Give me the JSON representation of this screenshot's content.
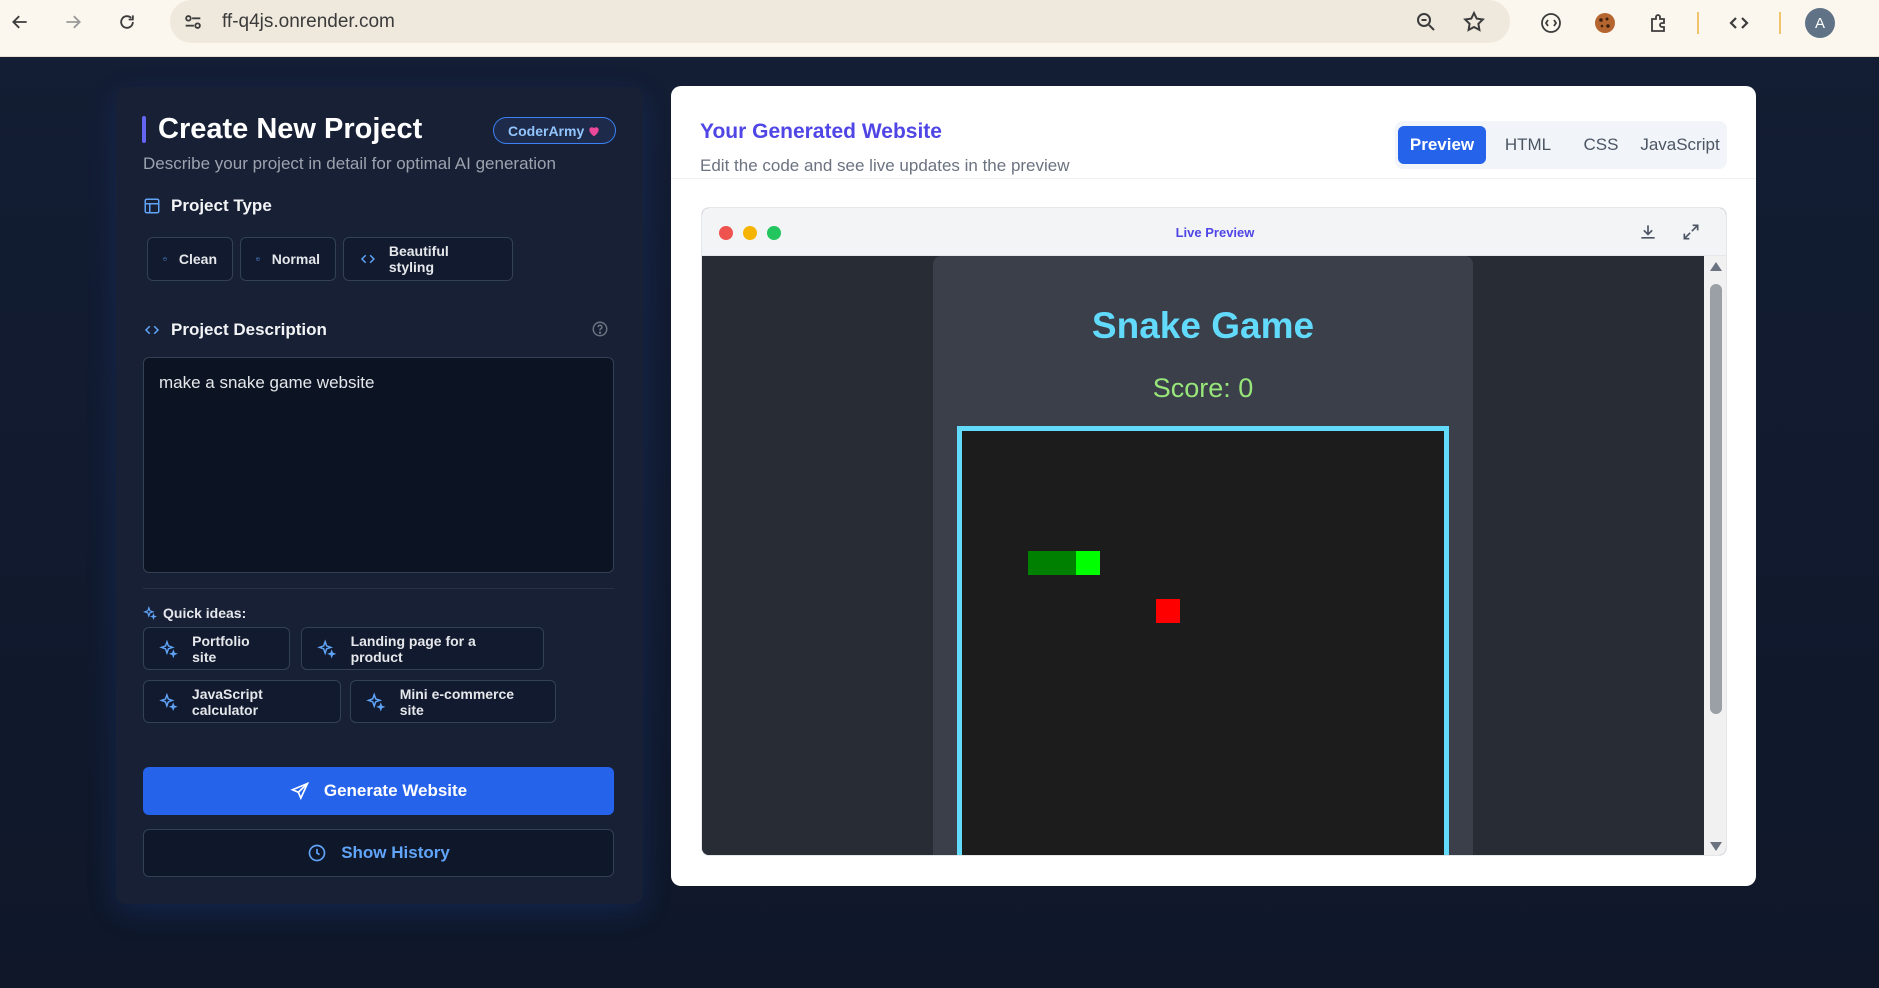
{
  "browser": {
    "url": "ff-q4js.onrender.com",
    "avatar_letter": "A"
  },
  "left_panel": {
    "title": "Create New Project",
    "badge": "CoderArmy",
    "badge_icon": "heart-icon",
    "subtitle": "Describe your project in detail for optimal AI generation",
    "project_type": {
      "label": "Project Type",
      "options": [
        {
          "label": "Clean",
          "icon": "square-icon"
        },
        {
          "label": "Normal",
          "icon": "layout-icon"
        },
        {
          "label": "Beautiful styling",
          "icon": "code-icon"
        }
      ]
    },
    "description": {
      "label": "Project Description",
      "value": "make a snake game website"
    },
    "quick_ideas": {
      "label": "Quick ideas:",
      "items": [
        "Portfolio site",
        "Landing page for a product",
        "JavaScript calculator",
        "Mini e-commerce site"
      ]
    },
    "generate_label": "Generate Website",
    "history_label": "Show History"
  },
  "right_panel": {
    "title": "Your Generated Website",
    "subtitle": "Edit the code and see live updates in the preview",
    "tabs": [
      {
        "label": "Preview",
        "active": true
      },
      {
        "label": "HTML",
        "active": false
      },
      {
        "label": "CSS",
        "active": false
      },
      {
        "label": "JavaScript",
        "active": false
      }
    ],
    "preview_label": "Live Preview"
  },
  "game": {
    "title": "Snake Game",
    "score_text": "Score: 0"
  },
  "colors": {
    "accent": "#2563eb",
    "title_accent": "#4f46e5",
    "game_title": "#61dafb",
    "score": "#98e67a",
    "food": "#ff0000"
  }
}
